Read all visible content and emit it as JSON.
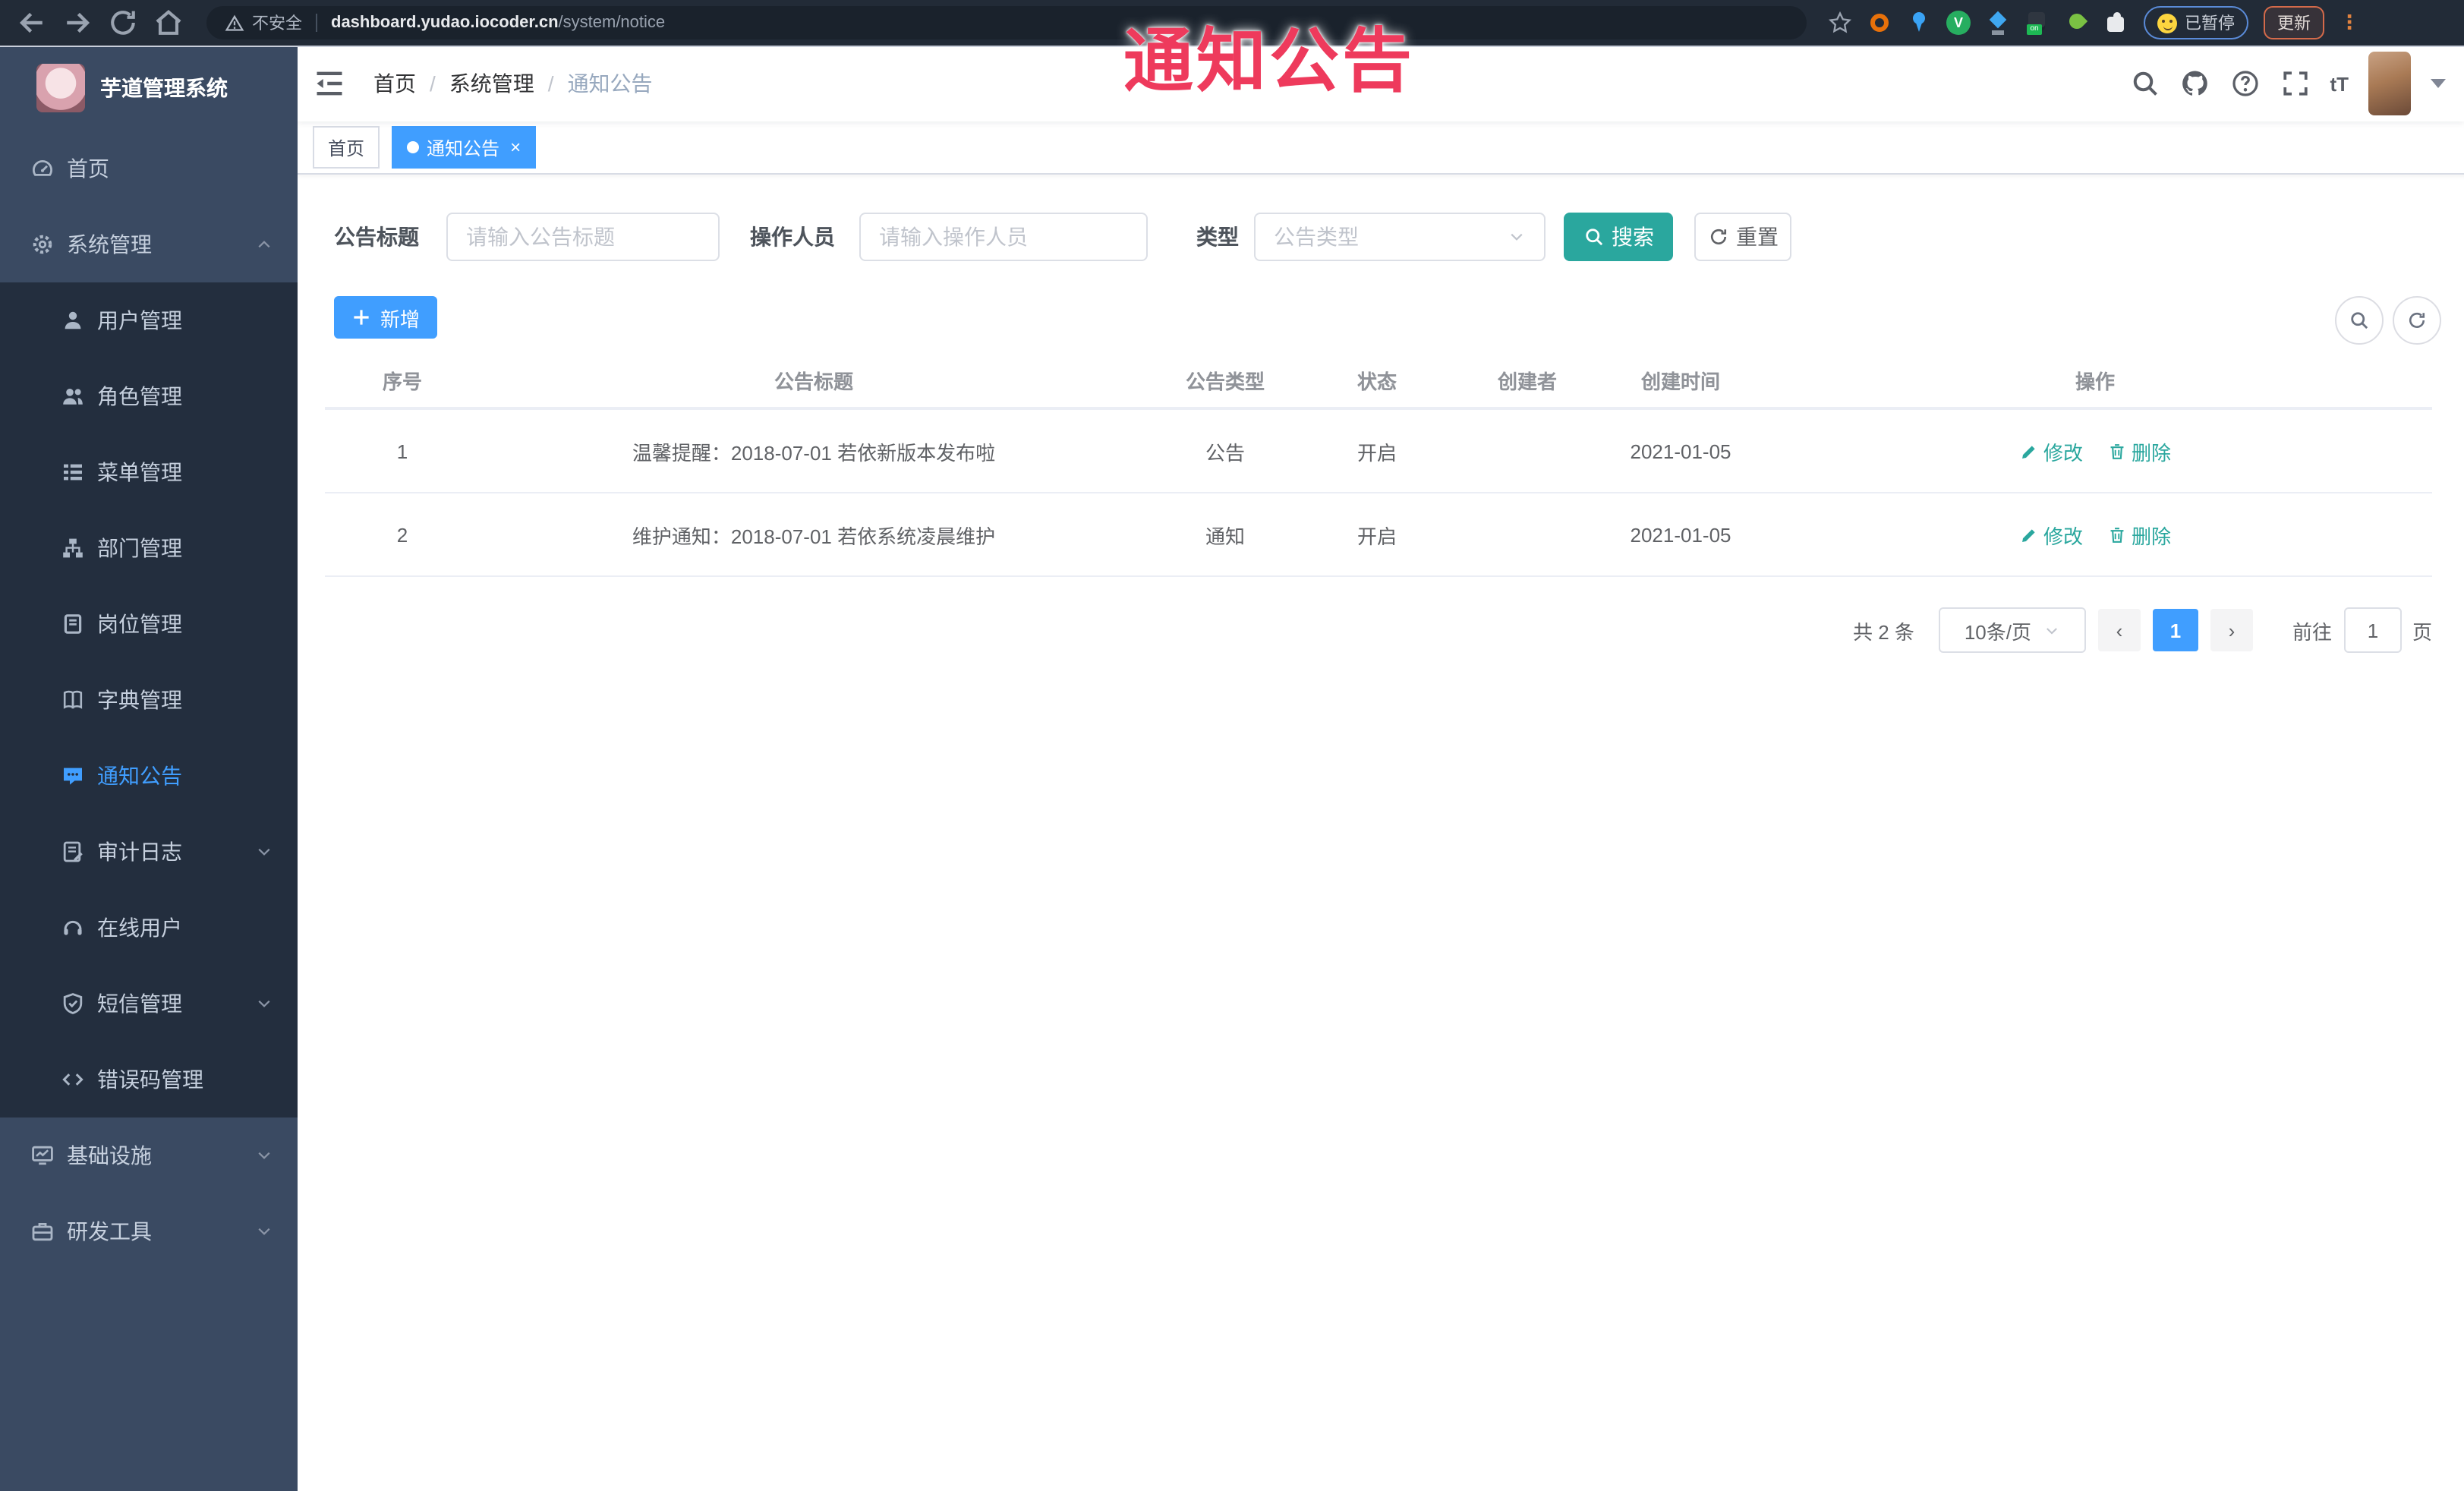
{
  "colors": {
    "accent_blue": "#409EFF",
    "teal_action": "#2aa79e",
    "overlay_red": "#ee3a5c",
    "sidebar_bg": "#3a4a62",
    "submenu_bg": "#232e3e"
  },
  "browser": {
    "security_label": "不安全",
    "url_host": "dashboard.yudao.iocoder.cn",
    "url_path": "/system/notice",
    "paused_label": "已暂停",
    "update_label": "更新",
    "extensions": [
      {
        "name": "ext-ring-icon"
      },
      {
        "name": "ext-pin-icon"
      },
      {
        "name": "ext-v-icon"
      },
      {
        "name": "ext-diamond-icon"
      },
      {
        "name": "ext-dark-on-icon"
      },
      {
        "name": "ext-leaf-icon"
      },
      {
        "name": "ext-puzzle-icon"
      }
    ]
  },
  "overlay": {
    "text": "通知公告"
  },
  "sidebar": {
    "title": "芋道管理系统",
    "items": [
      {
        "label": "首页",
        "icon": "dashboard-icon"
      },
      {
        "label": "系统管理",
        "icon": "gear-icon",
        "chevron": "up"
      },
      {
        "label": "用户管理",
        "icon": "user-icon",
        "sub": true
      },
      {
        "label": "角色管理",
        "icon": "users-icon",
        "sub": true
      },
      {
        "label": "菜单管理",
        "icon": "menu-list-icon",
        "sub": true
      },
      {
        "label": "部门管理",
        "icon": "org-tree-icon",
        "sub": true
      },
      {
        "label": "岗位管理",
        "icon": "badge-icon",
        "sub": true
      },
      {
        "label": "字典管理",
        "icon": "dictionary-icon",
        "sub": true
      },
      {
        "label": "通知公告",
        "icon": "message-icon",
        "sub": true,
        "active": true
      },
      {
        "label": "审计日志",
        "icon": "log-icon",
        "sub": true,
        "chevron": "down"
      },
      {
        "label": "在线用户",
        "icon": "headset-icon",
        "sub": true
      },
      {
        "label": "短信管理",
        "icon": "shield-icon",
        "sub": true,
        "chevron": "down"
      },
      {
        "label": "错误码管理",
        "icon": "code-icon",
        "sub": true
      },
      {
        "label": "基础设施",
        "icon": "monitor-icon",
        "chevron": "down"
      },
      {
        "label": "研发工具",
        "icon": "toolbox-icon",
        "chevron": "down"
      }
    ]
  },
  "breadcrumb": [
    "首页",
    "系统管理",
    "通知公告"
  ],
  "tabs": [
    {
      "label": "首页",
      "active": false,
      "closable": false
    },
    {
      "label": "通知公告",
      "active": true,
      "closable": true
    }
  ],
  "filters": {
    "title_label": "公告标题",
    "title_placeholder": "请输入公告标题",
    "operator_label": "操作人员",
    "operator_placeholder": "请输入操作人员",
    "type_label": "类型",
    "type_placeholder": "公告类型",
    "search_label": "搜索",
    "reset_label": "重置"
  },
  "toolbar": {
    "add_label": "新增"
  },
  "table": {
    "columns": [
      "序号",
      "公告标题",
      "公告类型",
      "状态",
      "创建者",
      "创建时间",
      "操作"
    ],
    "edit_label": "修改",
    "delete_label": "删除",
    "rows": [
      {
        "no": "1",
        "title": "温馨提醒：2018-07-01 若依新版本发布啦",
        "type": "公告",
        "status": "开启",
        "creator": "",
        "created": "2021-01-05"
      },
      {
        "no": "2",
        "title": "维护通知：2018-07-01 若依系统凌晨维护",
        "type": "通知",
        "status": "开启",
        "creator": "",
        "created": "2021-01-05"
      }
    ]
  },
  "pagination": {
    "total_label": "共 2 条",
    "page_size_label": "10条/页",
    "current_page": "1",
    "goto_label": "前往",
    "goto_value": "1",
    "page_unit_label": "页"
  }
}
